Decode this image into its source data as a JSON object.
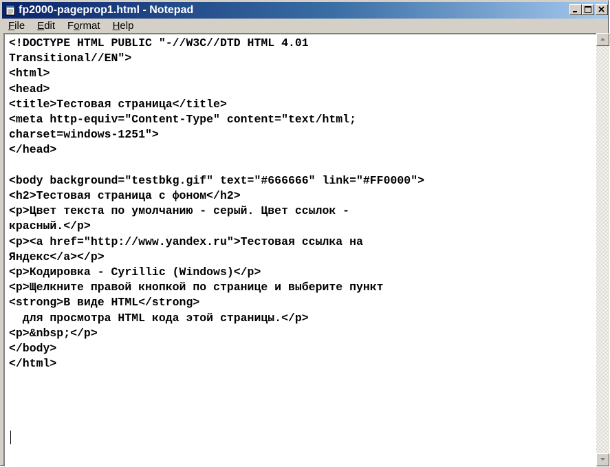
{
  "window": {
    "title": "fp2000-pageprop1.html - Notepad",
    "title_color": "#0a246a"
  },
  "menu": [
    {
      "label": "File",
      "accel": "F"
    },
    {
      "label": "Edit",
      "accel": "E"
    },
    {
      "label": "Format",
      "accel": "o"
    },
    {
      "label": "Help",
      "accel": "H"
    }
  ],
  "editor": {
    "content": "<!DOCTYPE HTML PUBLIC \"-//W3C//DTD HTML 4.01\nTransitional//EN\">\n<html>\n<head>\n<title>Тестовая страница</title>\n<meta http-equiv=\"Content-Type\" content=\"text/html;\ncharset=windows-1251\">\n</head>\n\n<body background=\"testbkg.gif\" text=\"#666666\" link=\"#FF0000\">\n<h2>Тестовая страница с фоном</h2>\n<p>Цвет текста по умолчанию - серый. Цвет ссылок -\nкрасный.</p>\n<p><a href=\"http://www.yandex.ru\">Тестовая ссылка на\nЯндекс</a></p>\n<p>Кодировка - Cyrillic (Windows)</p>\n<p>Щелкните правой кнопкой по странице и выберите пункт\n<strong>В виде HTML</strong>\n  для просмотра HTML кода этой страницы.</p>\n<p>&nbsp;</p>\n</body>\n</html>"
  },
  "icons": {
    "app": "notepad-icon",
    "minimize": "minimize-icon",
    "maximize": "maximize-icon",
    "close": "close-icon",
    "scroll_up": "arrow-up-icon",
    "scroll_down": "arrow-down-icon"
  }
}
